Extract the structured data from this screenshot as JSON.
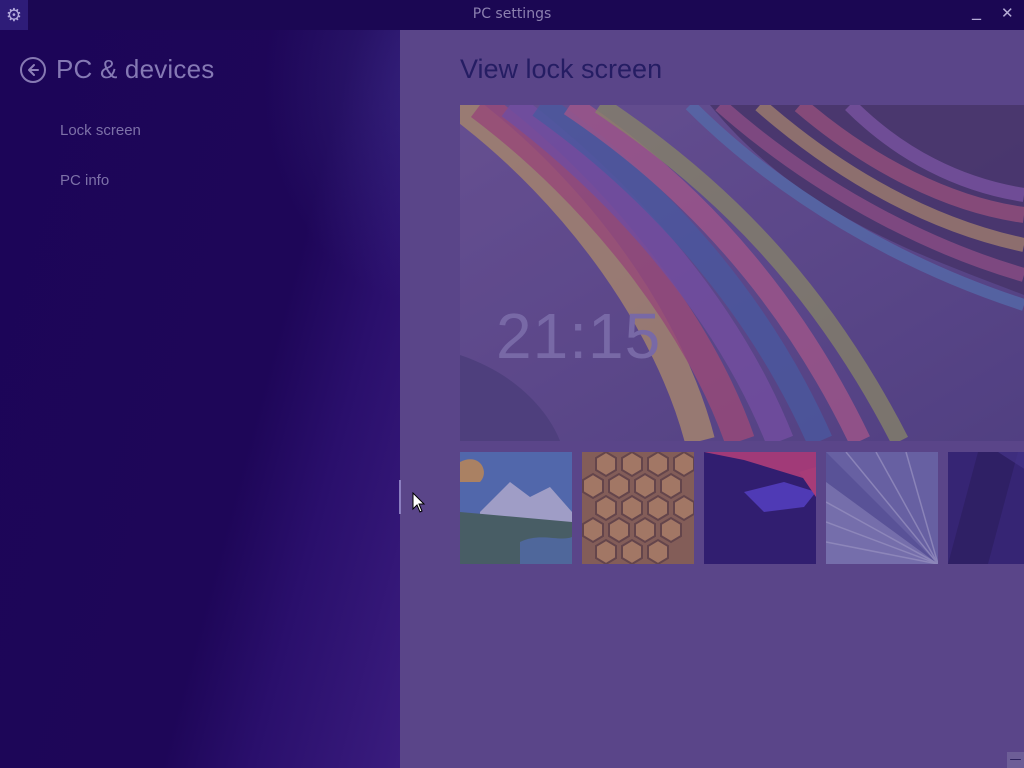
{
  "window": {
    "title": "PC settings",
    "icons": {
      "settings": "gear-icon",
      "minimize": "minimize-icon",
      "close": "close-icon"
    },
    "minimize_glyph": "_",
    "close_glyph": "✕"
  },
  "nav": {
    "back_icon": "back-arrow-icon",
    "section_title": "PC & devices",
    "items": [
      {
        "label": "Lock screen"
      },
      {
        "label": "PC info"
      }
    ]
  },
  "main": {
    "title": "View lock screen",
    "preview": {
      "time": "21:15"
    },
    "thumbnails": [
      {
        "name": "mountain-lake-thumbnail"
      },
      {
        "name": "honeycomb-thumbnail"
      },
      {
        "name": "purple-shapes-thumbnail"
      },
      {
        "name": "tunnel-thumbnail"
      },
      {
        "name": "dark-thumbnail"
      }
    ]
  },
  "colors": {
    "left_pane": "#1e0558",
    "right_pane": "#5a4589",
    "accent_text": "#8579b4",
    "title_text": "#251d63"
  }
}
